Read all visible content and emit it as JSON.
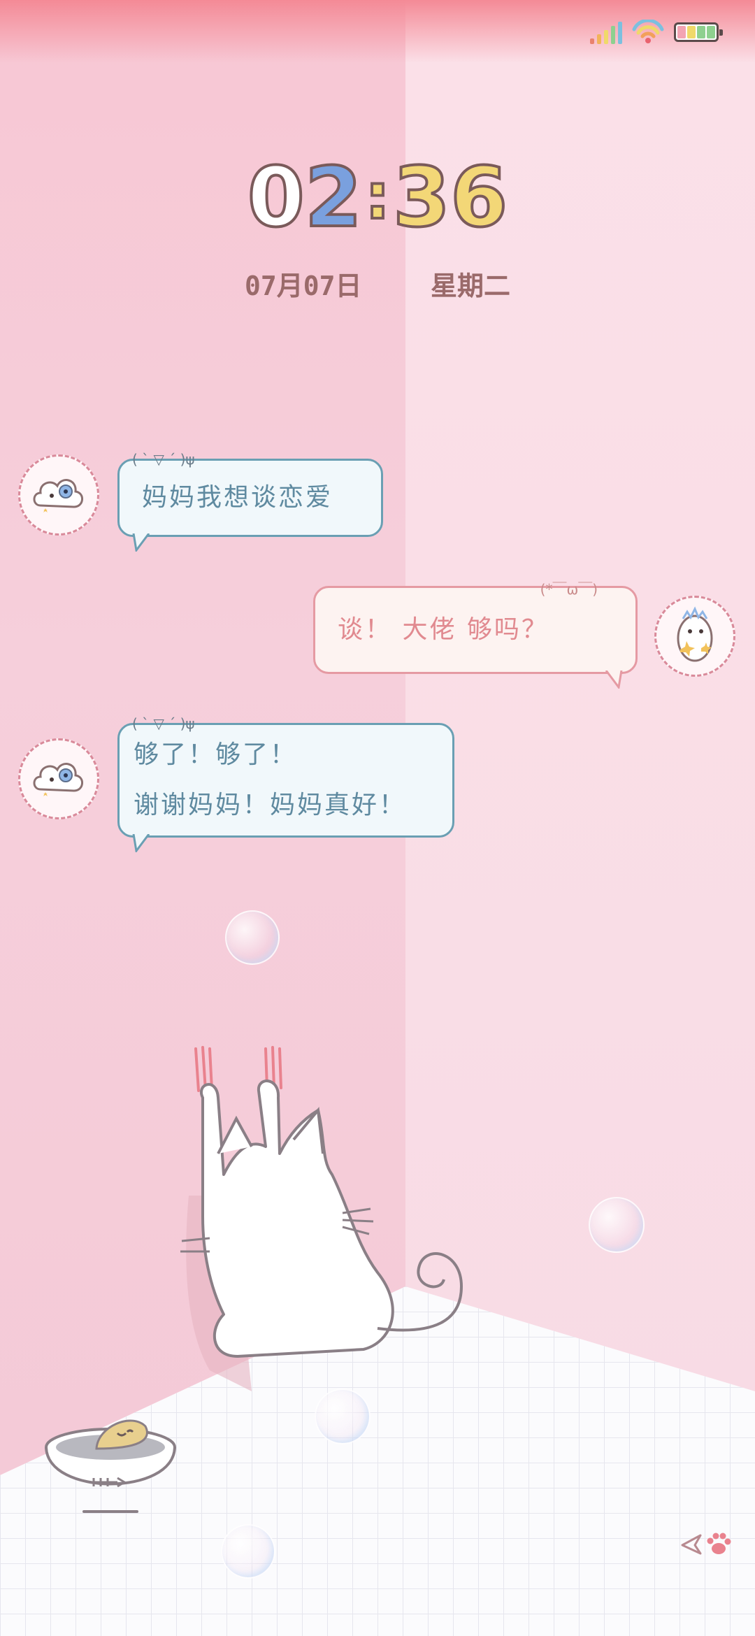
{
  "status_bar": {
    "signal_icon": "signal-bars-icon",
    "wifi_icon": "rainbow-wifi-icon",
    "battery_icon": "rainbow-battery-icon"
  },
  "clock": {
    "digit1": "0",
    "digit2": "2",
    "separator": ":",
    "digit3": "3",
    "digit4": "6",
    "colors": [
      "#ffffff",
      "#7aa0de",
      "#f3d777",
      "#f3d777"
    ]
  },
  "date": {
    "day": "07月07日",
    "weekday": "星期二"
  },
  "chat": [
    {
      "side": "left",
      "kaomoji": "( ˋ ▽ ˊ )ψ",
      "lines": [
        "妈妈我想谈恋爱"
      ],
      "avatar": "cloud-creature-icon"
    },
    {
      "side": "right",
      "kaomoji": "(*￣ω￣)",
      "lines": [
        "谈！ 大佬  够吗？"
      ],
      "avatar": "egg-chick-icon"
    },
    {
      "side": "left",
      "kaomoji": "( ˋ ▽ ˊ )ψ",
      "lines": [
        "够了！够了！",
        "谢谢妈妈！妈妈真好！"
      ],
      "avatar": "cloud-creature-icon"
    }
  ],
  "illustration": {
    "cat": "white-cat-scratching-wall-illustration",
    "bowl": "fish-bowl-icon",
    "bubbles": "soap-bubble-icon"
  },
  "footer_icons": [
    "paper-plane-icon",
    "paw-print-icon"
  ],
  "theme": {
    "accent_pink": "#e59aa3",
    "accent_blue": "#6a9fb3"
  }
}
